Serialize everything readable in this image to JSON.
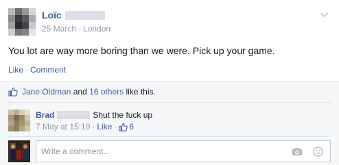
{
  "post": {
    "author": "Loïc",
    "date": "25 March",
    "location": "London",
    "separator": "·",
    "text": "You lot are way more boring than we were. Pick up your game.",
    "actions": {
      "like": "Like",
      "separator": "·",
      "comment": "Comment"
    }
  },
  "likes": {
    "first_name": "Jane Oldman",
    "and": "and",
    "others": "16 others",
    "suffix": "like this."
  },
  "comment": {
    "author": "Brad",
    "text": "Shut the fuck up",
    "time": "7 May at 15:19",
    "separator": "·",
    "like": "Like",
    "like_count": "6"
  },
  "composer": {
    "placeholder": "Write a comment..."
  },
  "colors": {
    "link": "#3b5998",
    "meta": "#9197a3",
    "ufi_bg": "#f6f7f9"
  },
  "icons": {
    "menu": "chevron-down-icon",
    "like": "thumbs-up-icon",
    "camera": "camera-icon",
    "emoji": "smiley-icon"
  }
}
